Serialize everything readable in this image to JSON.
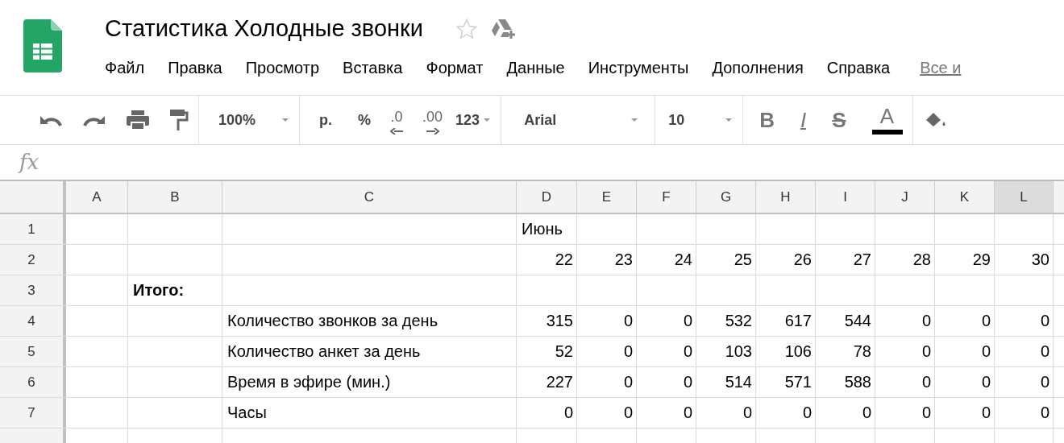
{
  "document": {
    "title": "Статистика Холодные звонки",
    "starred": false
  },
  "menu": [
    "Файл",
    "Правка",
    "Просмотр",
    "Вставка",
    "Формат",
    "Данные",
    "Инструменты",
    "Дополнения",
    "Справка"
  ],
  "menu_link": "Все и",
  "toolbar": {
    "zoom": "100%",
    "currency": "р.",
    "percent": "%",
    "decrease_decimals": ".0",
    "increase_decimals": ".00",
    "number_format": "123",
    "font": "Arial",
    "font_size": "10",
    "bold": "B",
    "italic": "I",
    "strikethrough": "S",
    "text_color": "A"
  },
  "formula_bar": {
    "label": "fx"
  },
  "sheet": {
    "columns": [
      {
        "label": "A",
        "selected": false
      },
      {
        "label": "B",
        "selected": false
      },
      {
        "label": "C",
        "selected": false
      },
      {
        "label": "D",
        "selected": false
      },
      {
        "label": "E",
        "selected": false
      },
      {
        "label": "F",
        "selected": false
      },
      {
        "label": "G",
        "selected": false
      },
      {
        "label": "H",
        "selected": false
      },
      {
        "label": "I",
        "selected": false
      },
      {
        "label": "J",
        "selected": false
      },
      {
        "label": "K",
        "selected": false
      },
      {
        "label": "L",
        "selected": true
      }
    ],
    "rows": [
      {
        "number": "1",
        "cells": [
          null,
          null,
          null,
          {
            "text": "Июнь",
            "kind": "text",
            "bold": false
          },
          null,
          null,
          null,
          null,
          null,
          null,
          null,
          null
        ]
      },
      {
        "number": "2",
        "cells": [
          null,
          null,
          null,
          {
            "text": "22",
            "kind": "number",
            "bold": false
          },
          {
            "text": "23",
            "kind": "number",
            "bold": false
          },
          {
            "text": "24",
            "kind": "number",
            "bold": false
          },
          {
            "text": "25",
            "kind": "number",
            "bold": false
          },
          {
            "text": "26",
            "kind": "number",
            "bold": false
          },
          {
            "text": "27",
            "kind": "number",
            "bold": false
          },
          {
            "text": "28",
            "kind": "number",
            "bold": false
          },
          {
            "text": "29",
            "kind": "number",
            "bold": false
          },
          {
            "text": "30",
            "kind": "number",
            "bold": false
          }
        ]
      },
      {
        "number": "3",
        "cells": [
          null,
          {
            "text": "Итого:",
            "kind": "text",
            "bold": true
          },
          null,
          null,
          null,
          null,
          null,
          null,
          null,
          null,
          null,
          null
        ]
      },
      {
        "number": "4",
        "cells": [
          null,
          null,
          {
            "text": "Количество звонков за день",
            "kind": "text",
            "bold": false
          },
          {
            "text": "315",
            "kind": "number",
            "bold": false
          },
          {
            "text": "0",
            "kind": "number",
            "bold": false
          },
          {
            "text": "0",
            "kind": "number",
            "bold": false
          },
          {
            "text": "532",
            "kind": "number",
            "bold": false
          },
          {
            "text": "617",
            "kind": "number",
            "bold": false
          },
          {
            "text": "544",
            "kind": "number",
            "bold": false
          },
          {
            "text": "0",
            "kind": "number",
            "bold": false
          },
          {
            "text": "0",
            "kind": "number",
            "bold": false
          },
          {
            "text": "0",
            "kind": "number",
            "bold": false
          }
        ]
      },
      {
        "number": "5",
        "cells": [
          null,
          null,
          {
            "text": "Количество анкет за день",
            "kind": "text",
            "bold": false
          },
          {
            "text": "52",
            "kind": "number",
            "bold": false
          },
          {
            "text": "0",
            "kind": "number",
            "bold": false
          },
          {
            "text": "0",
            "kind": "number",
            "bold": false
          },
          {
            "text": "103",
            "kind": "number",
            "bold": false
          },
          {
            "text": "106",
            "kind": "number",
            "bold": false
          },
          {
            "text": "78",
            "kind": "number",
            "bold": false
          },
          {
            "text": "0",
            "kind": "number",
            "bold": false
          },
          {
            "text": "0",
            "kind": "number",
            "bold": false
          },
          {
            "text": "0",
            "kind": "number",
            "bold": false
          }
        ]
      },
      {
        "number": "6",
        "cells": [
          null,
          null,
          {
            "text": "Время в эфире (мин.)",
            "kind": "text",
            "bold": false
          },
          {
            "text": "227",
            "kind": "number",
            "bold": false
          },
          {
            "text": "0",
            "kind": "number",
            "bold": false
          },
          {
            "text": "0",
            "kind": "number",
            "bold": false
          },
          {
            "text": "514",
            "kind": "number",
            "bold": false
          },
          {
            "text": "571",
            "kind": "number",
            "bold": false
          },
          {
            "text": "588",
            "kind": "number",
            "bold": false
          },
          {
            "text": "0",
            "kind": "number",
            "bold": false
          },
          {
            "text": "0",
            "kind": "number",
            "bold": false
          },
          {
            "text": "0",
            "kind": "number",
            "bold": false
          }
        ]
      },
      {
        "number": "7",
        "cells": [
          null,
          null,
          {
            "text": "Часы",
            "kind": "text",
            "bold": false
          },
          {
            "text": "0",
            "kind": "number",
            "bold": false
          },
          {
            "text": "0",
            "kind": "number",
            "bold": false
          },
          {
            "text": "0",
            "kind": "number",
            "bold": false
          },
          {
            "text": "0",
            "kind": "number",
            "bold": false
          },
          {
            "text": "0",
            "kind": "number",
            "bold": false
          },
          {
            "text": "0",
            "kind": "number",
            "bold": false
          },
          {
            "text": "0",
            "kind": "number",
            "bold": false
          },
          {
            "text": "0",
            "kind": "number",
            "bold": false
          },
          {
            "text": "0",
            "kind": "number",
            "bold": false
          }
        ]
      }
    ]
  }
}
